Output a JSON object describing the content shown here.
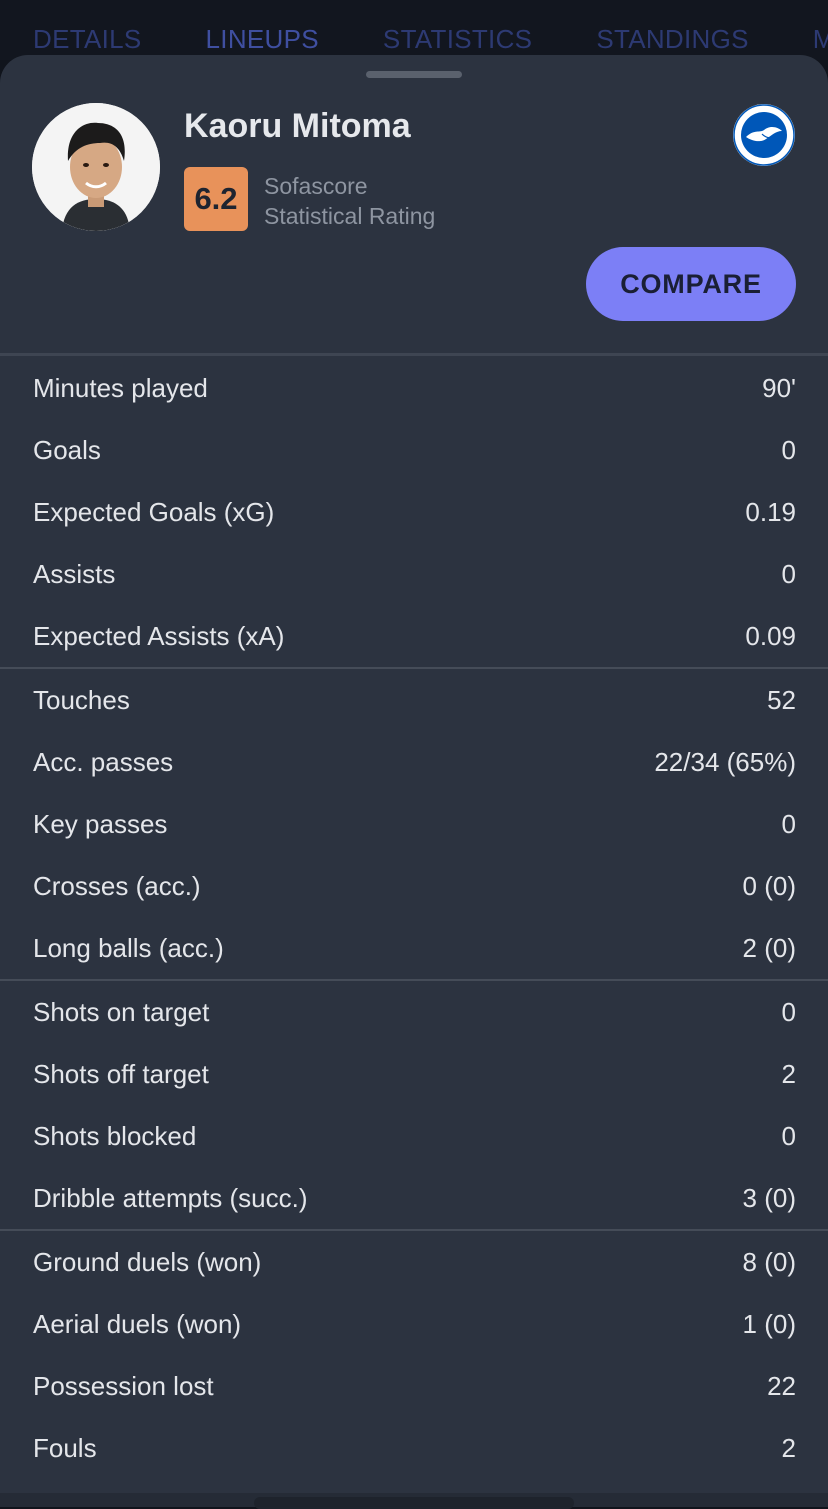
{
  "tabs": [
    "DETAILS",
    "LINEUPS",
    "STATISTICS",
    "STANDINGS",
    "M"
  ],
  "player": {
    "name": "Kaoru Mitoma",
    "rating": "6.2",
    "rating_label_line1": "Sofascore",
    "rating_label_line2": "Statistical Rating",
    "club_icon": "brighton-hove-albion-crest",
    "club_crest_text": "BRIGHTON & HOVE ALBION"
  },
  "compare_label": "COMPARE",
  "colors": {
    "rating_bg": "#e8925a",
    "compare_bg": "#7c7ff6",
    "sheet_bg": "#2c3340"
  },
  "stat_groups": [
    {
      "rows": [
        {
          "label": "Minutes played",
          "value": "90'"
        },
        {
          "label": "Goals",
          "value": "0"
        },
        {
          "label": "Expected Goals (xG)",
          "value": "0.19"
        },
        {
          "label": "Assists",
          "value": "0"
        },
        {
          "label": "Expected Assists (xA)",
          "value": "0.09"
        }
      ]
    },
    {
      "rows": [
        {
          "label": "Touches",
          "value": "52"
        },
        {
          "label": "Acc. passes",
          "value": "22/34 (65%)"
        },
        {
          "label": "Key passes",
          "value": "0"
        },
        {
          "label": "Crosses (acc.)",
          "value": "0 (0)"
        },
        {
          "label": "Long balls (acc.)",
          "value": "2 (0)"
        }
      ]
    },
    {
      "rows": [
        {
          "label": "Shots on target",
          "value": "0"
        },
        {
          "label": "Shots off target",
          "value": "2"
        },
        {
          "label": "Shots blocked",
          "value": "0"
        },
        {
          "label": "Dribble attempts (succ.)",
          "value": "3 (0)"
        }
      ]
    },
    {
      "rows": [
        {
          "label": "Ground duels (won)",
          "value": "8 (0)"
        },
        {
          "label": "Aerial duels (won)",
          "value": "1 (0)"
        },
        {
          "label": "Possession lost",
          "value": "22"
        },
        {
          "label": "Fouls",
          "value": "2"
        }
      ]
    }
  ]
}
